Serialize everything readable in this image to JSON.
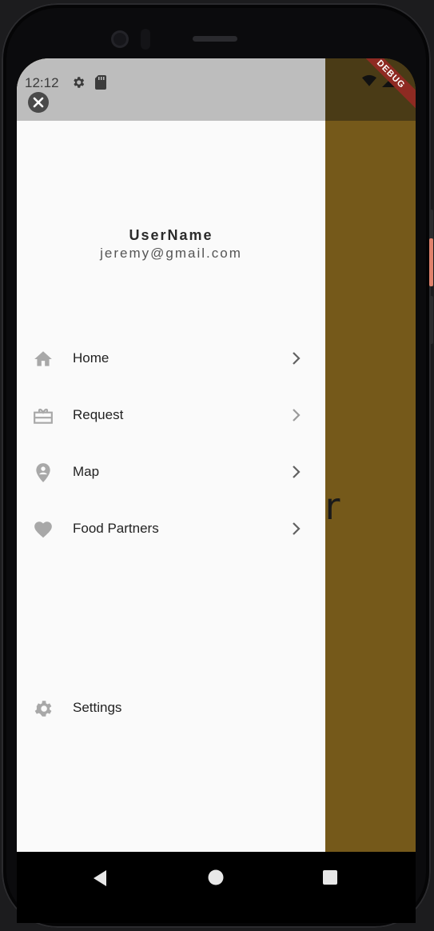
{
  "status_bar": {
    "time": "12:12",
    "icons": [
      "gear-icon",
      "sd-card-icon",
      "wifi-icon",
      "signal-icon"
    ]
  },
  "debug_banner": {
    "label": "DEBUG"
  },
  "background": {
    "partial_text": "tner",
    "color": "#75591a"
  },
  "drawer": {
    "close_icon": "close-icon",
    "user": {
      "name": "UserName",
      "email": "jeremy@gmail.com"
    },
    "items": [
      {
        "label": "Home",
        "icon": "home-icon"
      },
      {
        "label": "Request",
        "icon": "card-giftcard-icon"
      },
      {
        "label": "Map",
        "icon": "person-pin-icon"
      },
      {
        "label": "Food Partners",
        "icon": "heart-icon"
      }
    ],
    "settings": {
      "label": "Settings",
      "icon": "gear-icon"
    }
  },
  "nav_bar": {
    "back": "back-triangle-icon",
    "home": "home-circle-icon",
    "recents": "recents-square-icon"
  }
}
